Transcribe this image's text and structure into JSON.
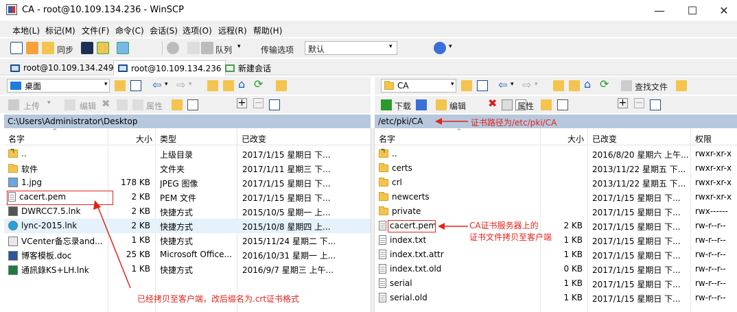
{
  "window": {
    "title": "CA - root@10.109.134.236 - WinSCP",
    "controls": {
      "minimize": "—",
      "maximize": "☐",
      "close": "✕"
    }
  },
  "menu": [
    "本地(L)",
    "标记(M)",
    "文件(F)",
    "命令(C)",
    "会话(S)",
    "选项(O)",
    "远程(R)",
    "帮助(H)"
  ],
  "toolbar": {
    "sync_label": "同步",
    "queue_label": "队列",
    "transfer_options_label": "传输选项",
    "transfer_options_value": "默认"
  },
  "tabs": [
    {
      "label": "root@10.109.134.249"
    },
    {
      "label": "root@10.109.134.236"
    },
    {
      "label": "新建会话"
    }
  ],
  "left": {
    "location": "桌面",
    "actions": {
      "upload": "上传",
      "edit": "编辑",
      "properties": "属性"
    },
    "path": "C:\\Users\\Administrator\\Desktop",
    "columns": {
      "name": "名字",
      "size": "大小",
      "type": "类型",
      "changed": "已改变"
    },
    "rows": [
      {
        "name": "..",
        "size": "",
        "type": "上级目录",
        "changed": "2017/1/15 星期日 下...",
        "icon": "up-icon"
      },
      {
        "name": "软件",
        "size": "",
        "type": "文件夹",
        "changed": "2017/1/11 星期三 下...",
        "icon": "folder-icon"
      },
      {
        "name": "1.jpg",
        "size": "178 KB",
        "type": "JPEG 图像",
        "changed": "2017/1/15 星期日 下...",
        "icon": "image-icon"
      },
      {
        "name": "cacert.pem",
        "size": "2 KB",
        "type": "PEM 文件",
        "changed": "2017/1/15 星期日 下...",
        "icon": "file-icon"
      },
      {
        "name": "DWRCC7.5.lnk",
        "size": "2 KB",
        "type": "快捷方式",
        "changed": "2015/10/5 星期一 上...",
        "icon": "shortcut-icon"
      },
      {
        "name": "lync-2015.lnk",
        "size": "2 KB",
        "type": "快捷方式",
        "changed": "2015/10/8 星期四 上...",
        "icon": "skype-icon"
      },
      {
        "name": "VCenter备忘录and...",
        "size": "1 KB",
        "type": "快捷方式",
        "changed": "2015/11/24 星期二 下...",
        "icon": "doc-shortcut-icon"
      },
      {
        "name": "博客模板.doc",
        "size": "25 KB",
        "type": "Microsoft Office...",
        "changed": "2016/10/31 星期一 上...",
        "icon": "word-icon"
      },
      {
        "name": "通訊錄KS+LH.lnk",
        "size": "1 KB",
        "type": "快捷方式",
        "changed": "2016/9/7 星期三 上午...",
        "icon": "excel-icon"
      }
    ],
    "annotation": "已经拷贝至客户端，改后缀名为.crt证书格式"
  },
  "right": {
    "location": "CA",
    "actions": {
      "download": "下载",
      "edit": "编辑",
      "properties": "属性"
    },
    "find_files": "查找文件",
    "path": "/etc/pki/CA",
    "path_annotation": "证书路径为/etc/pki/CA",
    "columns": {
      "name": "名字",
      "size": "大小",
      "changed": "已改变",
      "rights": "权限"
    },
    "rows": [
      {
        "name": "..",
        "size": "",
        "changed": "2016/8/20 星期六 上午...",
        "rights": "rwxr-xr-x",
        "icon": "up-icon"
      },
      {
        "name": "certs",
        "size": "",
        "changed": "2013/11/22 星期五 下...",
        "rights": "rwxr-xr-x",
        "icon": "folder-icon"
      },
      {
        "name": "crl",
        "size": "",
        "changed": "2013/11/22 星期五 下...",
        "rights": "rwxr-xr-x",
        "icon": "folder-icon"
      },
      {
        "name": "newcerts",
        "size": "",
        "changed": "2017/1/15 星期日 下...",
        "rights": "rwxr-xr-x",
        "icon": "folder-icon"
      },
      {
        "name": "private",
        "size": "",
        "changed": "2017/1/15 星期日 下...",
        "rights": "rwx------",
        "icon": "folder-icon"
      },
      {
        "name": "cacert.pem",
        "size": "2 KB",
        "changed": "2017/1/15 星期日 下...",
        "rights": "rw-r--r--",
        "icon": "file-icon"
      },
      {
        "name": "index.txt",
        "size": "1 KB",
        "changed": "2017/1/15 星期日 下...",
        "rights": "rw-r--r--",
        "icon": "file-icon"
      },
      {
        "name": "index.txt.attr",
        "size": "1 KB",
        "changed": "2017/1/15 星期日 下...",
        "rights": "rw-r--r--",
        "icon": "file-icon"
      },
      {
        "name": "index.txt.old",
        "size": "0 KB",
        "changed": "2017/1/15 星期日 下...",
        "rights": "rw-r--r--",
        "icon": "file-icon"
      },
      {
        "name": "serial",
        "size": "1 KB",
        "changed": "2017/1/15 星期日 下...",
        "rights": "rw-r--r--",
        "icon": "file-icon"
      },
      {
        "name": "serial.old",
        "size": "1 KB",
        "changed": "2017/1/15 星期日 下...",
        "rights": "rw-r--r--",
        "icon": "file-icon"
      }
    ],
    "annotation_line1": "CA证书服务器上的",
    "annotation_line2": "证书文件拷贝至客户端"
  },
  "colors": {
    "annotation": "#e2231a",
    "pathbar": "#b7c8dc",
    "chrome": "#f0f0f0"
  }
}
